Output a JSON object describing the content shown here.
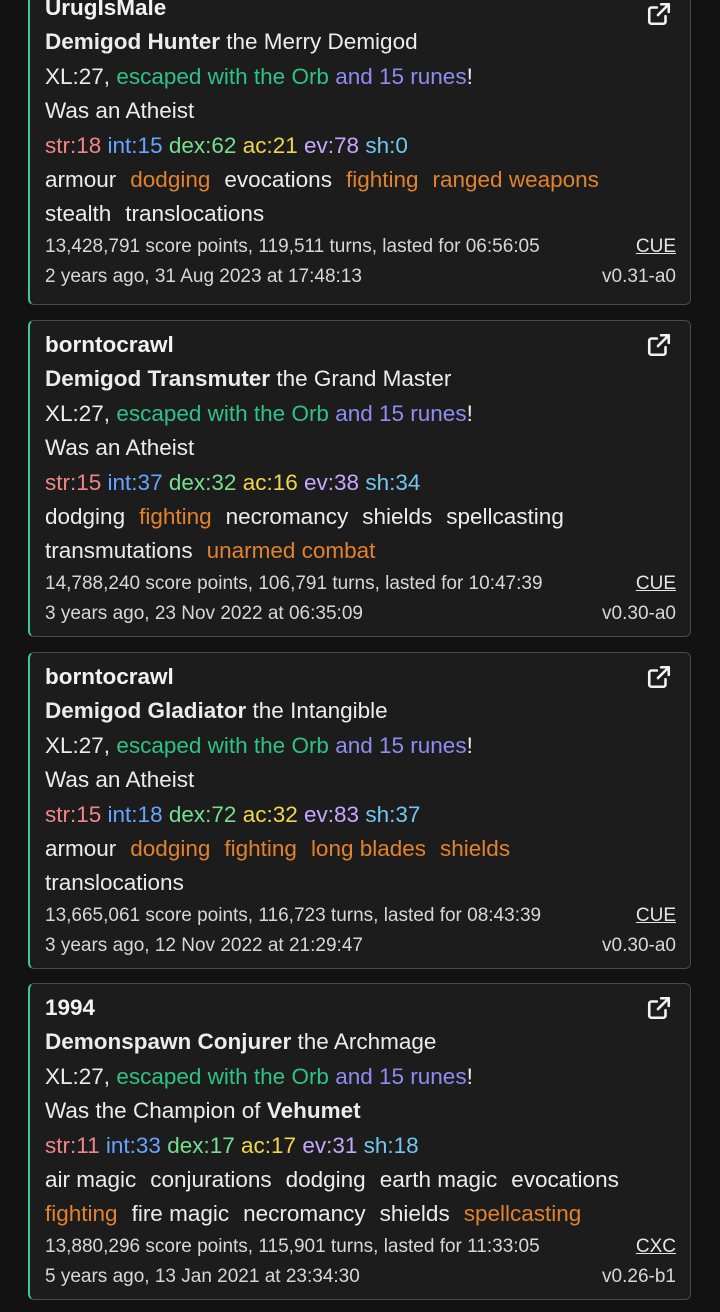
{
  "colors": {
    "card_border_left": "#3ec59a",
    "escaped": "#2fc18c",
    "runes": "#8f8cf2",
    "trained_skill": "#e2822c",
    "str": "#f08686",
    "int": "#66a4ff",
    "dex": "#74e08f",
    "ac": "#f0d74a",
    "ev": "#c7a7ff",
    "sh": "#72c7f0"
  },
  "games": [
    {
      "player": "UrugIsMale",
      "species_class": "Demigod Hunter",
      "title": "the Merry Demigod",
      "xl": "XL:27,",
      "escaped": "escaped with the Orb",
      "runes": "and 15 runes",
      "excl": "!",
      "god_prefix": "Was an Atheist",
      "god_name": "",
      "stats": {
        "str": "str:18",
        "int": "int:15",
        "dex": "dex:62",
        "ac": "ac:21",
        "ev": "ev:78",
        "sh": "sh:0"
      },
      "skills_line1": [
        {
          "name": "armour",
          "trained": false
        },
        {
          "name": "dodging",
          "trained": true
        },
        {
          "name": "evocations",
          "trained": false
        },
        {
          "name": "fighting",
          "trained": true
        },
        {
          "name": "ranged weapons",
          "trained": true
        }
      ],
      "skills_line2": [
        {
          "name": "stealth",
          "trained": false
        },
        {
          "name": "translocations",
          "trained": false
        }
      ],
      "score": "13,428,791 score points, 119,511 turns, lasted for 06:56:05",
      "server": "CUE",
      "date": "2 years ago, 31 Aug 2023 at 17:48:13",
      "version": "v0.31-a0",
      "icon": "external-link-icon"
    },
    {
      "player": "borntocrawl",
      "species_class": "Demigod Transmuter",
      "title": "the Grand Master",
      "xl": "XL:27,",
      "escaped": "escaped with the Orb",
      "runes": "and 15 runes",
      "excl": "!",
      "god_prefix": "Was an Atheist",
      "god_name": "",
      "stats": {
        "str": "str:15",
        "int": "int:37",
        "dex": "dex:32",
        "ac": "ac:16",
        "ev": "ev:38",
        "sh": "sh:34"
      },
      "skills_line1": [
        {
          "name": "dodging",
          "trained": false
        },
        {
          "name": "fighting",
          "trained": true
        },
        {
          "name": "necromancy",
          "trained": false
        },
        {
          "name": "shields",
          "trained": false
        },
        {
          "name": "spellcasting",
          "trained": false
        }
      ],
      "skills_line2": [
        {
          "name": "transmutations",
          "trained": false
        },
        {
          "name": "unarmed combat",
          "trained": true
        }
      ],
      "score": "14,788,240 score points, 106,791 turns, lasted for 10:47:39",
      "server": "CUE",
      "date": "3 years ago, 23 Nov 2022 at 06:35:09",
      "version": "v0.30-a0",
      "icon": "external-link-icon"
    },
    {
      "player": "borntocrawl",
      "species_class": "Demigod Gladiator",
      "title": "the Intangible",
      "xl": "XL:27,",
      "escaped": "escaped with the Orb",
      "runes": "and 15 runes",
      "excl": "!",
      "god_prefix": "Was an Atheist",
      "god_name": "",
      "stats": {
        "str": "str:15",
        "int": "int:18",
        "dex": "dex:72",
        "ac": "ac:32",
        "ev": "ev:83",
        "sh": "sh:37"
      },
      "skills_line1": [
        {
          "name": "armour",
          "trained": false
        },
        {
          "name": "dodging",
          "trained": true
        },
        {
          "name": "fighting",
          "trained": true
        },
        {
          "name": "long blades",
          "trained": true
        },
        {
          "name": "shields",
          "trained": true
        }
      ],
      "skills_line2": [
        {
          "name": "translocations",
          "trained": false
        }
      ],
      "score": "13,665,061 score points, 116,723 turns, lasted for 08:43:39",
      "server": "CUE",
      "date": "3 years ago, 12 Nov 2022 at 21:29:47",
      "version": "v0.30-a0",
      "icon": "external-link-icon"
    },
    {
      "player": "1994",
      "species_class": "Demonspawn Conjurer",
      "title": "the Archmage",
      "xl": "XL:27,",
      "escaped": "escaped with the Orb",
      "runes": "and 15 runes",
      "excl": "!",
      "god_prefix": "Was the Champion of",
      "god_name": "Vehumet",
      "stats": {
        "str": "str:11",
        "int": "int:33",
        "dex": "dex:17",
        "ac": "ac:17",
        "ev": "ev:31",
        "sh": "sh:18"
      },
      "skills_line1": [
        {
          "name": "air magic",
          "trained": false
        },
        {
          "name": "conjurations",
          "trained": false
        },
        {
          "name": "dodging",
          "trained": false
        },
        {
          "name": "earth magic",
          "trained": false
        },
        {
          "name": "evocations",
          "trained": false
        }
      ],
      "skills_line2": [
        {
          "name": "fighting",
          "trained": true
        },
        {
          "name": "fire magic",
          "trained": false
        },
        {
          "name": "necromancy",
          "trained": false
        },
        {
          "name": "shields",
          "trained": false
        },
        {
          "name": "spellcasting",
          "trained": true
        }
      ],
      "score": "13,880,296 score points, 115,901 turns, lasted for 11:33:05",
      "server": "CXC",
      "date": "5 years ago, 13 Jan 2021 at 23:34:30",
      "version": "v0.26-b1",
      "icon": "external-link-icon"
    }
  ]
}
